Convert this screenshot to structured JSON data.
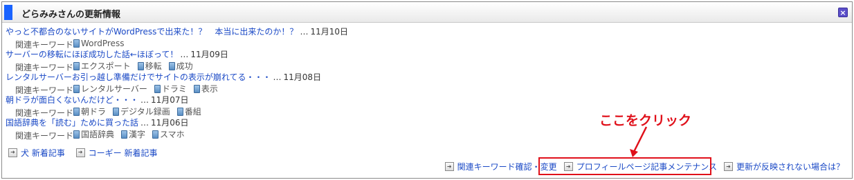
{
  "header": {
    "title": "どらみみさんの更新情報",
    "close_icon": "close-icon"
  },
  "entries": [
    {
      "title": "やっと不都合のないサイトがWordPressで出来た！？　本当に出来たのか！？",
      "dots": "…",
      "date": "11月10日",
      "kw_label": "関連キーワード",
      "keywords": [
        "WordPress"
      ]
    },
    {
      "title": "サーバーの移転にほぼ成功した話←ほぼって！",
      "dots": "…",
      "date": "11月09日",
      "kw_label": "関連キーワード",
      "keywords": [
        "エクスポート",
        "移転",
        "成功"
      ]
    },
    {
      "title": "レンタルサーバーお引っ越し準備だけでサイトの表示が崩れてる・・・",
      "dots": "…",
      "date": "11月08日",
      "kw_label": "関連キーワード",
      "keywords": [
        "レンタルサーバー",
        "ドラミ",
        "表示"
      ]
    },
    {
      "title": "朝ドラが面白くないんだけど・・・",
      "dots": "…",
      "date": "11月07日",
      "kw_label": "関連キーワード",
      "keywords": [
        "朝ドラ",
        "デジタル録画",
        "番組"
      ]
    },
    {
      "title": "国語辞典を「読む」ために買った話",
      "dots": "…",
      "date": "11月06日",
      "kw_label": "関連キーワード",
      "keywords": [
        "国語辞典",
        "漢字",
        "スマホ"
      ]
    }
  ],
  "links": {
    "dog": "犬 新着記事",
    "coffee": "コーギー 新着記事",
    "keyword_confirm": "関連キーワード確認・変更",
    "profile_maint": "プロフィールページ記事メンテナンス",
    "not_reflected": "更新が反映されない場合は？"
  },
  "annotation": {
    "text": "ここをクリック",
    "color": "#e0101a"
  },
  "colors": {
    "accent": "#1a63ff",
    "link": "#1a49c6",
    "highlight": "#e0101a"
  }
}
